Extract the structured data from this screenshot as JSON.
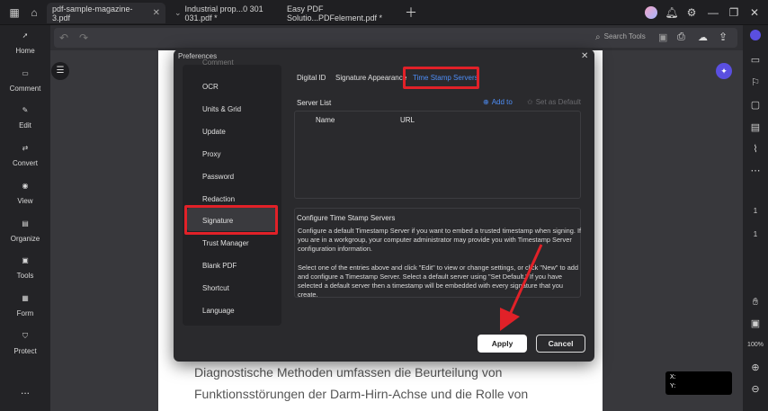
{
  "titlebar": {
    "tabs": [
      {
        "label": "pdf-sample-magazine-3.pdf"
      },
      {
        "label": "Industrial  prop...0 301 031.pdf *"
      },
      {
        "label": "Easy PDF Solutio...PDFelement.pdf *"
      }
    ]
  },
  "toolbar": {
    "search_label": "Search Tools"
  },
  "sidebar": {
    "items": [
      {
        "label": "Home"
      },
      {
        "label": "Comment"
      },
      {
        "label": "Edit"
      },
      {
        "label": "Convert"
      },
      {
        "label": "View"
      },
      {
        "label": "Organize"
      },
      {
        "label": "Tools"
      },
      {
        "label": "Form"
      },
      {
        "label": "Protect"
      }
    ],
    "more": "..."
  },
  "document": {
    "line1": "Diagnostische Methoden umfassen die Beurteilung von",
    "line2": "Funktionsstörungen der Darm-Hirn-Achse und die Rolle von"
  },
  "rightrail": {
    "page_current": "1",
    "page_total": "1",
    "zoom": "100%"
  },
  "coords": {
    "x": "X:",
    "y": "Y:"
  },
  "dialog": {
    "title": "Preferences",
    "nav": [
      {
        "label": "Comment"
      },
      {
        "label": "OCR"
      },
      {
        "label": "Units & Grid"
      },
      {
        "label": "Update"
      },
      {
        "label": "Proxy"
      },
      {
        "label": "Password"
      },
      {
        "label": "Redaction"
      },
      {
        "label": "Signature"
      },
      {
        "label": "Trust Manager"
      },
      {
        "label": "Blank PDF"
      },
      {
        "label": "Shortcut"
      },
      {
        "label": "Language"
      }
    ],
    "tabs": [
      {
        "label": "Digital ID"
      },
      {
        "label": "Signature Appearance"
      },
      {
        "label": "Time Stamp Servers"
      }
    ],
    "server_list_label": "Server List",
    "add_to": "Add to",
    "set_default": "Set as Default",
    "columns": [
      "Name",
      "URL"
    ],
    "config_title": "Configure Time Stamp Servers",
    "config_p1": "Configure a default Timestamp Server if you want to embed a trusted timestamp when signing. If you are in a workgroup, your computer administrator may provide you with Timestamp Server configuration information.",
    "config_p2": "Select one of the entries above and click \"Edit\" to view or change settings, or click \"New\" to add and configure a Timestamp Server. Select a default server using \"Set Default.\" If you have selected a default server then a timestamp will be embedded with every signature that you create.",
    "apply": "Apply",
    "cancel": "Cancel"
  },
  "colors": {
    "accent": "#4e8ef7",
    "highlight": "#e12128"
  }
}
